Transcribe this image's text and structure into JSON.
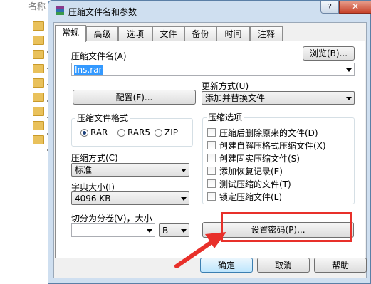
{
  "background": {
    "header": "名称"
  },
  "dialog": {
    "title": "压缩文件名和参数",
    "help_glyph": "?",
    "close_glyph": "✕",
    "tabs": [
      "常规",
      "高级",
      "选项",
      "文件",
      "备份",
      "时间",
      "注释"
    ],
    "active_tab": "常规"
  },
  "general": {
    "archive_name_label": "压缩文件名(A)",
    "archive_name_value": "Ins.rar",
    "browse_button": "浏览(B)...",
    "update_mode_label": "更新方式(U)",
    "update_mode_value": "添加并替换文件",
    "profiles_button": "配置(F)...",
    "format_group": "压缩文件格式",
    "formats": [
      "RAR",
      "RAR5",
      "ZIP"
    ],
    "selected_format": "RAR",
    "options_group": "压缩选项",
    "options": [
      "压缩后删除原来的文件(D)",
      "创建自解压格式压缩文件(X)",
      "创建固实压缩文件(S)",
      "添加恢复记录(E)",
      "测试压缩的文件(T)",
      "锁定压缩文件(L)"
    ],
    "method_label": "压缩方式(C)",
    "method_value": "标准",
    "dict_label": "字典大小(I)",
    "dict_value": "4096 KB",
    "split_label": "切分为分卷(V)，大小",
    "split_value": "",
    "split_unit": "B",
    "set_password_button": "设置密码(P)..."
  },
  "footer": {
    "ok": "确定",
    "cancel": "取消",
    "help": "帮助"
  },
  "colors": {
    "highlight": "#e8302a",
    "selection": "#3399ff",
    "frame": "#cfdff0"
  }
}
